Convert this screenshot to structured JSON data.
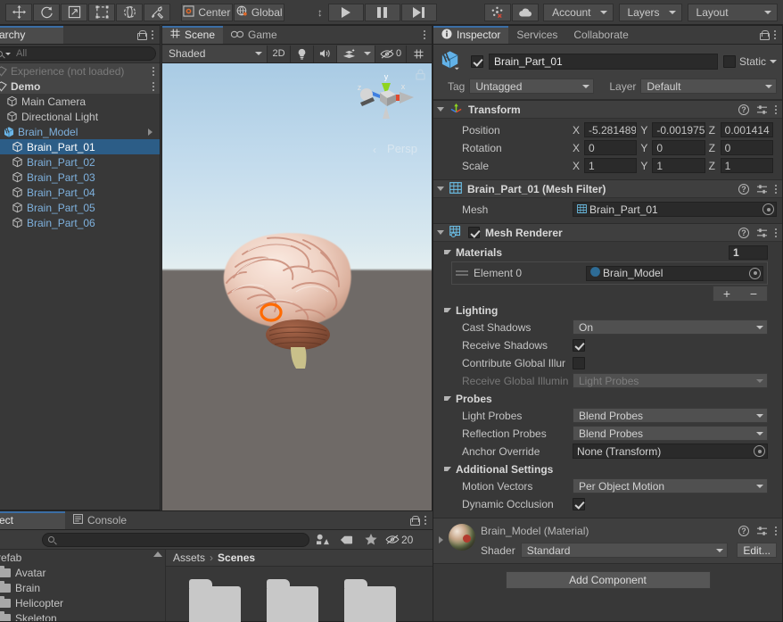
{
  "toolbar": {
    "tools": [
      {
        "name": "hand-tool",
        "icon": "move-arrows"
      },
      {
        "name": "rotate-tool",
        "icon": "rotate"
      },
      {
        "name": "scale-tool",
        "icon": "scale"
      },
      {
        "name": "rect-tool",
        "icon": "rect"
      },
      {
        "name": "transform-tool",
        "icon": "globe-transform"
      },
      {
        "name": "custom-tool",
        "icon": "wrench"
      }
    ],
    "pivot_label": "Center",
    "space_label": "Global",
    "play_label": "Play",
    "pause_label": "Pause",
    "step_label": "Step",
    "collab_label": "Collab",
    "cloud_label": "Cloud",
    "account_label": "Account",
    "layers_label": "Layers",
    "layout_label": "Layout"
  },
  "hierarchy": {
    "tab_label": "archy",
    "search_placeholder": "All",
    "items": [
      {
        "label": "Experience (not loaded)",
        "type": "scene",
        "state": "unloaded",
        "depth": 0
      },
      {
        "label": "Demo",
        "type": "scene",
        "state": "loaded",
        "depth": 0
      },
      {
        "label": "Main Camera",
        "type": "gameobject",
        "depth": 1
      },
      {
        "label": "Directional Light",
        "type": "gameobject",
        "depth": 1
      },
      {
        "label": "Brain_Model",
        "type": "prefab",
        "depth": 1,
        "expanded": true
      },
      {
        "label": "Brain_Part_01",
        "type": "prefab-child",
        "depth": 2,
        "selected": true
      },
      {
        "label": "Brain_Part_02",
        "type": "prefab-child",
        "depth": 2
      },
      {
        "label": "Brain_Part_03",
        "type": "prefab-child",
        "depth": 2
      },
      {
        "label": "Brain_Part_04",
        "type": "prefab-child",
        "depth": 2
      },
      {
        "label": "Brain_Part_05",
        "type": "prefab-child",
        "depth": 2
      },
      {
        "label": "Brain_Part_06",
        "type": "prefab-child",
        "depth": 2
      }
    ]
  },
  "scene": {
    "tabs": [
      {
        "label": "Scene",
        "active": true
      },
      {
        "label": "Game",
        "active": false
      }
    ],
    "draw_mode": "Shaded",
    "toggle_2d": "2D",
    "hidden_count": "0",
    "projection_label": "Persp",
    "gizmo_axes": {
      "x": "x",
      "y": "y",
      "z": "z"
    }
  },
  "inspector": {
    "tabs": [
      {
        "label": "Inspector",
        "active": true
      },
      {
        "label": "Services",
        "active": false
      },
      {
        "label": "Collaborate",
        "active": false
      }
    ],
    "object": {
      "name": "Brain_Part_01",
      "enabled": true,
      "static_label": "Static",
      "static_checked": false,
      "tag_label": "Tag",
      "tag_value": "Untagged",
      "layer_label": "Layer",
      "layer_value": "Default"
    },
    "transform": {
      "title": "Transform",
      "rows": [
        {
          "label": "Position",
          "x": "-5.281489",
          "y": "-0.001975",
          "z": "0.001414"
        },
        {
          "label": "Rotation",
          "x": "0",
          "y": "0",
          "z": "0"
        },
        {
          "label": "Scale",
          "x": "1",
          "y": "1",
          "z": "1"
        }
      ],
      "axis_x": "X",
      "axis_y": "Y",
      "axis_z": "Z"
    },
    "mesh_filter": {
      "title": "Brain_Part_01 (Mesh Filter)",
      "mesh_label": "Mesh",
      "mesh_value": "Brain_Part_01"
    },
    "mesh_renderer": {
      "title": "Mesh Renderer",
      "enabled": true,
      "materials": {
        "title": "Materials",
        "count": "1",
        "element_label": "Element 0",
        "element_value": "Brain_Model",
        "add_label": "+",
        "remove_label": "−"
      },
      "lighting": {
        "title": "Lighting",
        "cast_shadows_label": "Cast Shadows",
        "cast_shadows_value": "On",
        "receive_shadows_label": "Receive Shadows",
        "receive_shadows_checked": true,
        "contribute_gi_label": "Contribute Global Illur",
        "contribute_gi_checked": false,
        "receive_gi_label": "Receive Global Illumin",
        "receive_gi_value": "Light Probes"
      },
      "probes": {
        "title": "Probes",
        "light_probes_label": "Light Probes",
        "light_probes_value": "Blend Probes",
        "reflection_probes_label": "Reflection Probes",
        "reflection_probes_value": "Blend Probes",
        "anchor_override_label": "Anchor Override",
        "anchor_override_value": "None (Transform)"
      },
      "additional": {
        "title": "Additional Settings",
        "motion_vectors_label": "Motion Vectors",
        "motion_vectors_value": "Per Object Motion",
        "dynamic_occlusion_label": "Dynamic Occlusion",
        "dynamic_occlusion_checked": true
      }
    },
    "material_preview": {
      "title": "Brain_Model (Material)",
      "shader_label": "Shader",
      "shader_value": "Standard",
      "edit_label": "Edit..."
    },
    "add_component_label": "Add Component"
  },
  "project": {
    "tabs": [
      {
        "label": "ect",
        "active": true
      },
      {
        "label": "Console",
        "active": false
      }
    ],
    "search_placeholder": "",
    "hidden_count": "20",
    "tree": [
      {
        "label": "Prefab",
        "depth": 0
      },
      {
        "label": "Avatar",
        "depth": 1
      },
      {
        "label": "Brain",
        "depth": 1
      },
      {
        "label": "Helicopter",
        "depth": 1
      },
      {
        "label": "Skeleton",
        "depth": 1
      }
    ],
    "breadcrumb": {
      "root": "Assets",
      "separator": "›",
      "current": "Scenes"
    },
    "grid_items": [
      {
        "name": "folder-item-1"
      },
      {
        "name": "folder-item-2"
      },
      {
        "name": "folder-item-3"
      }
    ]
  },
  "colors": {
    "selection": "#2c5d87",
    "prefab_blue": "#7eb1de",
    "accent_orange": "#ff6a00",
    "panel_bg": "#383838",
    "header_bg": "#3f3f3f"
  }
}
